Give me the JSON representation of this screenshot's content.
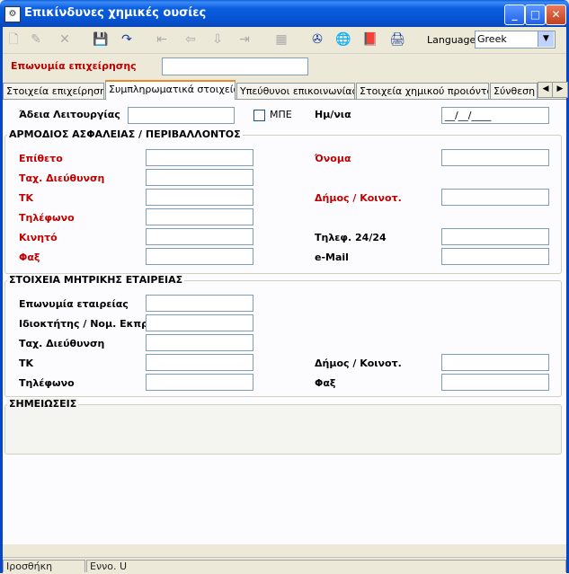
{
  "window": {
    "title": "Επικίνδυνες χημικές ουσίες",
    "minimize_glyph": "_",
    "maximize_glyph": "□",
    "close_glyph": "✕",
    "title_icon": "app-icon"
  },
  "toolbar": {
    "language_label": "Language",
    "language_value": "Greek",
    "dropdown_glyph": "▼",
    "buttons": [
      {
        "name": "new-record-icon",
        "glyph": "🗋",
        "enabled": false
      },
      {
        "name": "edit-record-icon",
        "glyph": "✎",
        "enabled": false
      },
      {
        "name": "delete-record-icon",
        "glyph": "✕",
        "enabled": false
      },
      {
        "name": "save-icon",
        "glyph": "💾",
        "enabled": true
      },
      {
        "name": "refresh-icon",
        "glyph": "↷",
        "enabled": true
      },
      {
        "name": "first-record-icon",
        "glyph": "⇤",
        "enabled": false
      },
      {
        "name": "previous-record-icon",
        "glyph": "⇦",
        "enabled": false
      },
      {
        "name": "next-record-icon",
        "glyph": "⇩",
        "enabled": false
      },
      {
        "name": "last-record-icon",
        "glyph": "⇥",
        "enabled": false
      },
      {
        "name": "grid-icon",
        "glyph": "▦",
        "enabled": false
      },
      {
        "name": "tools-icon",
        "glyph": "✇",
        "enabled": true
      },
      {
        "name": "globe-icon",
        "glyph": "🌐",
        "enabled": true
      },
      {
        "name": "book-icon",
        "glyph": "📕",
        "enabled": true
      },
      {
        "name": "print-icon",
        "glyph": "🖨",
        "enabled": true
      }
    ]
  },
  "company": {
    "label": "Επωνυμία επιχείρησης",
    "value": ""
  },
  "tabs": [
    {
      "label": "Στοιχεία επιχείρησης",
      "active": false
    },
    {
      "label": "Συμπληρωματικά στοιχεία",
      "active": true
    },
    {
      "label": "Υπεύθυνοι επικοινωνίας",
      "active": false
    },
    {
      "label": "Στοιχεία χημικού προιόντος",
      "active": false
    },
    {
      "label": "Σύνθεση",
      "active": false
    }
  ],
  "tab_scroll": {
    "left": "◀",
    "right": "▶"
  },
  "license": {
    "label": "Άδεια Λειτουργίας",
    "value": "",
    "mpe_label": "ΜΠΕ",
    "mpe_checked": false,
    "date_label": "Ημ/νια",
    "date_value": "__/__/____"
  },
  "safety_group": {
    "title": "ΑΡΜΟΔΙΟΣ ΑΣΦΑΛΕΙΑΣ / ΠΕΡΙΒΑΛΛΟΝΤΟΣ",
    "surname_label": "Επίθετο",
    "name_label": "Όνομα",
    "address_label": "Ταχ. Διεύθυνση",
    "zip_label": "ΤΚ",
    "municipality_label": "Δήμος / Κοινοτ.",
    "phone_label": "Τηλέφωνο",
    "mobile_label": "Κινητό",
    "phone24_label": "Τηλεφ. 24/24",
    "fax_label": "Φαξ",
    "email_label": "e-Mail"
  },
  "parent_group": {
    "title": "ΣΤΟΙΧΕΙΑ ΜΗΤΡΙΚΗΣ ΕΤΑΙΡΕΙΑΣ",
    "company_label": "Επωνυμία εταιρείας",
    "owner_label": "Ιδιοκτήτης / Νομ. Εκπρ.",
    "address_label": "Ταχ. Διεύθυνση",
    "zip_label": "ΤΚ",
    "municipality_label": "Δήμος / Κοινοτ.",
    "phone_label": "Τηλέφωνο",
    "fax_label": "Φαξ"
  },
  "notes_group": {
    "title": "ΣΗΜΕΙΩΣΕΙΣ"
  },
  "status": {
    "left": "Ιροσθήκη",
    "right": "Εννο. U"
  },
  "colors": {
    "title_bar": "#0a5fd8",
    "required_label": "#c00000",
    "active_tab_accent": "#e68b2c"
  }
}
